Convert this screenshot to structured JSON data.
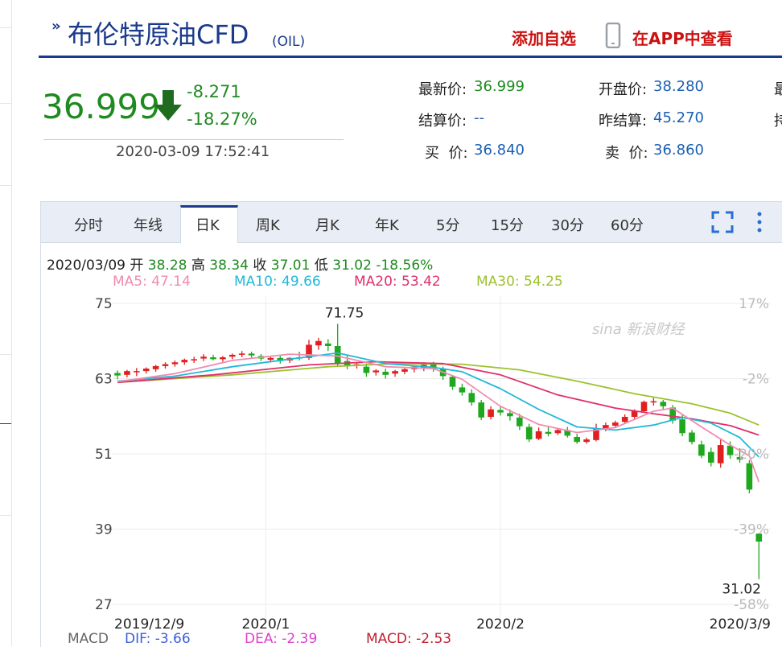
{
  "header": {
    "title": "布伦特原油CFD",
    "subtitle": "(OIL)",
    "add_watchlist": "添加自选",
    "view_in_app": "在APP中查看"
  },
  "price": {
    "last": "36.999",
    "change": "-8.271",
    "change_pct": "-18.27%",
    "timestamp": "2020-03-09 17:52:41",
    "direction": "down"
  },
  "quote": {
    "latest_label": "最新价:",
    "latest_value": "36.999",
    "open_label": "开盘价:",
    "open_value": "38.280",
    "settle_label": "结算价:",
    "settle_value": "--",
    "prev_settle_label": "昨结算:",
    "prev_settle_value": "45.270",
    "bid_label": "买  价:",
    "bid_value": "36.840",
    "ask_label": "卖  价:",
    "ask_value": "36.860",
    "clipped_1": "最",
    "clipped_2": "持"
  },
  "tabs": [
    {
      "label": "分时"
    },
    {
      "label": "年线"
    },
    {
      "label": "日K",
      "active": true
    },
    {
      "label": "周K"
    },
    {
      "label": "月K"
    },
    {
      "label": "年K"
    },
    {
      "label": "5分"
    },
    {
      "label": "15分"
    },
    {
      "label": "30分"
    },
    {
      "label": "60分"
    }
  ],
  "info": {
    "date": "2020/03/09",
    "open_label": "开",
    "open": "38.28",
    "high_label": "高",
    "high": "38.34",
    "close_label": "收",
    "close": "37.01",
    "low_label": "低",
    "low": "31.02",
    "pct": "-18.56%"
  },
  "ma": {
    "ma5": "MA5: 47.14",
    "ma10": "MA10: 49.66",
    "ma20": "MA20: 53.42",
    "ma30": "MA30: 54.25"
  },
  "macd": {
    "label": "MACD",
    "dif": "DIF: -3.66",
    "dea": "DEA: -2.39",
    "macd": "MACD: -2.53"
  },
  "watermark": "sina 新浪财经",
  "colors": {
    "up": "#e02020",
    "down": "#1fa81f",
    "ma5": "#f08cb0",
    "ma10": "#22b8d8",
    "ma20": "#e0306a",
    "ma30": "#9cc22e",
    "brand": "#1a3a8a",
    "accent_red": "#cc1111"
  },
  "chart_data": {
    "type": "candlestick",
    "y_ticks": [
      75,
      63,
      51,
      39,
      27
    ],
    "ylim": [
      27,
      75
    ],
    "pct_ticks": [
      "17%",
      "-2%",
      "-20%",
      "-39%",
      "-58%"
    ],
    "x_ticks": [
      "2019/12/9",
      "2020/1",
      "2020/2",
      "2020/3/9"
    ],
    "annotations": {
      "high": "71.75",
      "low": "31.02"
    },
    "candles": [
      {
        "o": 63.9,
        "h": 64.3,
        "c": 63.5,
        "l": 62.9
      },
      {
        "o": 63.6,
        "h": 64.4,
        "c": 64.2,
        "l": 63.2
      },
      {
        "o": 64.1,
        "h": 64.7,
        "c": 64.2,
        "l": 63.4
      },
      {
        "o": 64.2,
        "h": 64.8,
        "c": 64.6,
        "l": 63.8
      },
      {
        "o": 64.5,
        "h": 65.2,
        "c": 65.0,
        "l": 64.1
      },
      {
        "o": 65.0,
        "h": 65.6,
        "c": 65.3,
        "l": 64.6
      },
      {
        "o": 65.3,
        "h": 65.9,
        "c": 65.6,
        "l": 64.9
      },
      {
        "o": 65.6,
        "h": 66.2,
        "c": 66.0,
        "l": 65.2
      },
      {
        "o": 65.9,
        "h": 66.5,
        "c": 66.1,
        "l": 65.5
      },
      {
        "o": 66.2,
        "h": 66.9,
        "c": 66.5,
        "l": 65.8
      },
      {
        "o": 66.4,
        "h": 66.8,
        "c": 66.1,
        "l": 65.9
      },
      {
        "o": 66.1,
        "h": 66.6,
        "c": 66.4,
        "l": 65.7
      },
      {
        "o": 66.5,
        "h": 67.0,
        "c": 66.8,
        "l": 66.1
      },
      {
        "o": 66.8,
        "h": 67.4,
        "c": 67.0,
        "l": 66.4
      },
      {
        "o": 67.0,
        "h": 67.3,
        "c": 66.7,
        "l": 66.3
      },
      {
        "o": 66.6,
        "h": 66.9,
        "c": 66.2,
        "l": 65.8
      },
      {
        "o": 66.0,
        "h": 66.6,
        "c": 66.3,
        "l": 65.6
      },
      {
        "o": 66.3,
        "h": 66.8,
        "c": 65.8,
        "l": 65.4
      },
      {
        "o": 65.9,
        "h": 66.4,
        "c": 66.3,
        "l": 65.5
      },
      {
        "o": 66.4,
        "h": 67.3,
        "c": 66.2,
        "l": 65.9
      },
      {
        "o": 66.3,
        "h": 69.2,
        "c": 68.4,
        "l": 66.0
      },
      {
        "o": 68.3,
        "h": 69.5,
        "c": 69.0,
        "l": 67.6
      },
      {
        "o": 68.6,
        "h": 69.3,
        "c": 68.2,
        "l": 67.4
      },
      {
        "o": 68.2,
        "h": 71.75,
        "c": 65.4,
        "l": 65.0
      },
      {
        "o": 65.8,
        "h": 66.7,
        "c": 65.0,
        "l": 64.5
      },
      {
        "o": 65.1,
        "h": 65.6,
        "c": 65.3,
        "l": 64.6
      },
      {
        "o": 64.9,
        "h": 65.4,
        "c": 63.9,
        "l": 63.3
      },
      {
        "o": 64.0,
        "h": 64.5,
        "c": 64.3,
        "l": 63.5
      },
      {
        "o": 64.1,
        "h": 64.6,
        "c": 63.6,
        "l": 63.0
      },
      {
        "o": 63.8,
        "h": 64.4,
        "c": 64.2,
        "l": 63.3
      },
      {
        "o": 64.1,
        "h": 64.7,
        "c": 64.5,
        "l": 63.7
      },
      {
        "o": 64.5,
        "h": 65.1,
        "c": 64.9,
        "l": 64.0
      },
      {
        "o": 64.7,
        "h": 65.6,
        "c": 65.2,
        "l": 64.2
      },
      {
        "o": 65.3,
        "h": 65.7,
        "c": 64.6,
        "l": 64.1
      },
      {
        "o": 64.5,
        "h": 64.9,
        "c": 63.4,
        "l": 62.8
      },
      {
        "o": 63.3,
        "h": 63.6,
        "c": 61.7,
        "l": 61.2
      },
      {
        "o": 61.6,
        "h": 62.2,
        "c": 60.8,
        "l": 60.3
      },
      {
        "o": 60.7,
        "h": 61.3,
        "c": 59.2,
        "l": 58.7
      },
      {
        "o": 59.2,
        "h": 59.6,
        "c": 56.8,
        "l": 56.4
      },
      {
        "o": 56.9,
        "h": 58.6,
        "c": 58.1,
        "l": 56.5
      },
      {
        "o": 58.0,
        "h": 58.5,
        "c": 57.6,
        "l": 57.1
      },
      {
        "o": 57.5,
        "h": 58.1,
        "c": 57.0,
        "l": 56.3
      },
      {
        "o": 56.8,
        "h": 57.4,
        "c": 55.4,
        "l": 54.8
      },
      {
        "o": 55.3,
        "h": 55.8,
        "c": 53.3,
        "l": 52.9
      },
      {
        "o": 53.4,
        "h": 55.2,
        "c": 54.6,
        "l": 53.2
      },
      {
        "o": 54.5,
        "h": 55.4,
        "c": 54.2,
        "l": 53.8
      },
      {
        "o": 54.3,
        "h": 55.1,
        "c": 54.8,
        "l": 54.0
      },
      {
        "o": 54.8,
        "h": 55.3,
        "c": 53.9,
        "l": 53.6
      },
      {
        "o": 53.7,
        "h": 54.2,
        "c": 52.9,
        "l": 52.6
      },
      {
        "o": 52.9,
        "h": 53.6,
        "c": 53.3,
        "l": 52.6
      },
      {
        "o": 53.2,
        "h": 55.8,
        "c": 55.0,
        "l": 53.0
      },
      {
        "o": 55.0,
        "h": 56.0,
        "c": 55.6,
        "l": 54.6
      },
      {
        "o": 55.5,
        "h": 56.3,
        "c": 56.0,
        "l": 55.2
      },
      {
        "o": 56.1,
        "h": 57.3,
        "c": 56.9,
        "l": 55.9
      },
      {
        "o": 56.9,
        "h": 58.1,
        "c": 57.8,
        "l": 56.6
      },
      {
        "o": 57.8,
        "h": 59.5,
        "c": 59.3,
        "l": 57.7
      },
      {
        "o": 59.2,
        "h": 59.9,
        "c": 59.4,
        "l": 58.7
      },
      {
        "o": 59.3,
        "h": 59.6,
        "c": 58.6,
        "l": 58.0
      },
      {
        "o": 58.4,
        "h": 58.8,
        "c": 56.3,
        "l": 55.8
      },
      {
        "o": 56.5,
        "h": 57.3,
        "c": 54.3,
        "l": 53.8
      },
      {
        "o": 54.4,
        "h": 54.8,
        "c": 52.9,
        "l": 52.5
      },
      {
        "o": 52.5,
        "h": 53.1,
        "c": 50.7,
        "l": 50.3
      },
      {
        "o": 51.3,
        "h": 52.0,
        "c": 49.6,
        "l": 49.0
      },
      {
        "o": 49.5,
        "h": 53.5,
        "c": 52.4,
        "l": 48.8
      },
      {
        "o": 52.3,
        "h": 53.0,
        "c": 50.8,
        "l": 50.2
      },
      {
        "o": 50.5,
        "h": 51.9,
        "c": 50.1,
        "l": 49.6
      },
      {
        "o": 49.5,
        "h": 50.0,
        "c": 45.3,
        "l": 44.7
      },
      {
        "o": 38.28,
        "h": 38.34,
        "c": 37.01,
        "l": 31.02
      }
    ],
    "ma5": [
      [
        0,
        62.5
      ],
      [
        6,
        63.8
      ],
      [
        12,
        65.9
      ],
      [
        18,
        66.9
      ],
      [
        23,
        66.6
      ],
      [
        28,
        64.9
      ],
      [
        33,
        64.6
      ],
      [
        36,
        62.9
      ],
      [
        40,
        58.6
      ],
      [
        44,
        55.7
      ],
      [
        48,
        54.4
      ],
      [
        52,
        55.2
      ],
      [
        56,
        57.8
      ],
      [
        58,
        58.3
      ],
      [
        61,
        55.3
      ],
      [
        64,
        52.4
      ],
      [
        66,
        50.7
      ],
      [
        67,
        46.5
      ]
    ],
    "ma10": [
      [
        0,
        62.6
      ],
      [
        6,
        63.4
      ],
      [
        12,
        64.9
      ],
      [
        18,
        66.1
      ],
      [
        23,
        67.1
      ],
      [
        28,
        65.4
      ],
      [
        33,
        64.8
      ],
      [
        36,
        64.1
      ],
      [
        40,
        61.4
      ],
      [
        44,
        58.1
      ],
      [
        48,
        55.3
      ],
      [
        52,
        54.8
      ],
      [
        56,
        55.6
      ],
      [
        59,
        56.8
      ],
      [
        62,
        55.9
      ],
      [
        65,
        53.6
      ],
      [
        67,
        50.5
      ]
    ],
    "ma20": [
      [
        0,
        62.4
      ],
      [
        10,
        63.6
      ],
      [
        20,
        65.2
      ],
      [
        27,
        65.7
      ],
      [
        34,
        65.4
      ],
      [
        40,
        63.6
      ],
      [
        46,
        60.4
      ],
      [
        52,
        58.3
      ],
      [
        56,
        57.4
      ],
      [
        60,
        56.6
      ],
      [
        64,
        55.5
      ],
      [
        67,
        54.0
      ]
    ],
    "ma30": [
      [
        0,
        62.4
      ],
      [
        12,
        63.6
      ],
      [
        22,
        64.9
      ],
      [
        29,
        65.4
      ],
      [
        36,
        65.3
      ],
      [
        42,
        64.4
      ],
      [
        48,
        62.6
      ],
      [
        54,
        60.6
      ],
      [
        60,
        59.0
      ],
      [
        64,
        57.5
      ],
      [
        67,
        55.6
      ]
    ]
  }
}
